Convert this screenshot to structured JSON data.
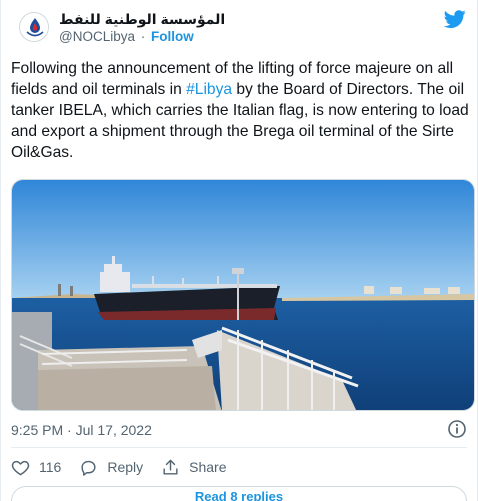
{
  "account": {
    "display_name": "المؤسسة الوطنية للنفط",
    "handle": "@NOCLibya",
    "separator": "·",
    "follow_label": "Follow",
    "avatar_icon": "noc-logo-icon"
  },
  "brand": {
    "icon": "twitter-bird-icon",
    "color": "#1d9bf0"
  },
  "tweet": {
    "text_before_hashtag": "Following the announcement of the lifting of force majeure on all fields and oil terminals in ",
    "hashtag": "#Libya",
    "text_after_hashtag": " by the Board of Directors. The oil tanker IBELA, which carries the Italian flag, is now entering to load and export a shipment through the Brega oil terminal of the Sirte Oil&Gas.",
    "timestamp": "9:25 PM · Jul 17, 2022",
    "info_icon": "info-icon"
  },
  "actions": {
    "like": {
      "icon": "heart-icon",
      "count": "116"
    },
    "reply": {
      "icon": "reply-icon",
      "label": "Reply"
    },
    "share": {
      "icon": "share-icon",
      "label": "Share"
    }
  },
  "replies": {
    "label": "Read 8 replies"
  },
  "colors": {
    "link": "#1b95e0",
    "text": "#0f1419",
    "muted": "#536471",
    "border": "#cfd9de"
  }
}
